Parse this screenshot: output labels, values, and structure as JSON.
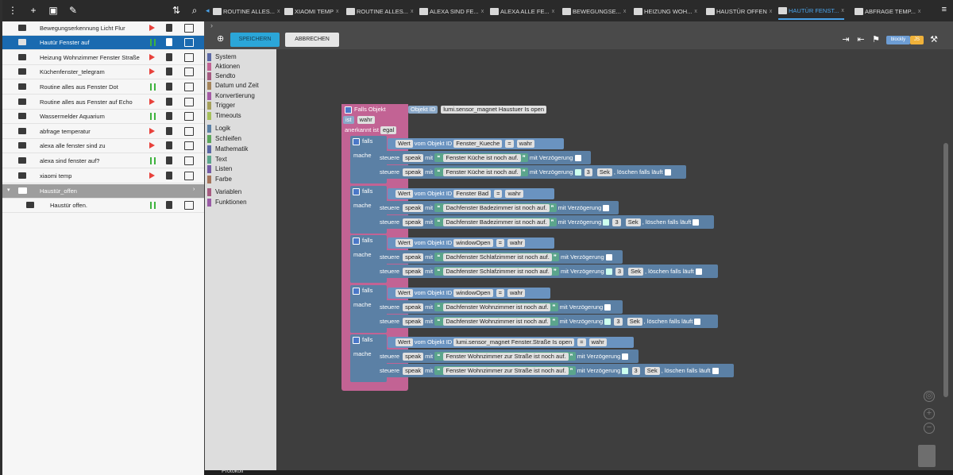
{
  "tabs": [
    {
      "label": "ROUTINE ALLES...",
      "x": "x"
    },
    {
      "label": "XIAOMI TEMP",
      "x": "x"
    },
    {
      "label": "ROUTINE ALLES...",
      "x": "x"
    },
    {
      "label": "ALEXA SIND FE...",
      "x": "x"
    },
    {
      "label": "ALEXA ALLE FE...",
      "x": "x"
    },
    {
      "label": "BEWEGUNGSE...",
      "x": "x"
    },
    {
      "label": "HEIZUNG WOH...",
      "x": "x"
    },
    {
      "label": "HAUSTÜR OFFEN",
      "x": "x"
    },
    {
      "label": "HAUTÜR FENST...",
      "x": "x"
    },
    {
      "label": "ABFRAGE TEMP...",
      "x": "x"
    }
  ],
  "toolbar": {
    "save_label": "SPEICHERN",
    "cancel_label": "ABBRECHEN",
    "blockly_label": "blockly",
    "js_label": "JS"
  },
  "sidebar": {
    "items": [
      {
        "name": "Bewegungserkennung Licht Flur"
      },
      {
        "name": "Hautür Fenster auf"
      },
      {
        "name": "Heizung Wohnzimmer Fenster Straße"
      },
      {
        "name": "Küchenfenster_telegram"
      },
      {
        "name": "Routine alles aus Fenster Dot"
      },
      {
        "name": "Routine alles aus Fenster auf Echo"
      },
      {
        "name": "Wassermelder Aquarium"
      },
      {
        "name": "abfrage temperatur"
      },
      {
        "name": "alexa alle fenster sind zu"
      },
      {
        "name": "alexa sind fenster auf?"
      },
      {
        "name": "xiaomi temp"
      },
      {
        "name": "Haustür_offen"
      },
      {
        "name": "Haustür offen."
      }
    ]
  },
  "categories": [
    "System",
    "Aktionen",
    "Sendto",
    "Datum und Zeit",
    "Konvertierung",
    "Trigger",
    "Timeouts",
    "Logik",
    "Schleifen",
    "Mathematik",
    "Text",
    "Listen",
    "Farbe",
    "Variablen",
    "Funktionen"
  ],
  "cat_colors": [
    "#5b67a5",
    "#c26394",
    "#a55b80",
    "#a5845b",
    "#a55ba5",
    "#a5a05b",
    "#a5c05b",
    "#5b80a5",
    "#5ba55b",
    "#5b67a5",
    "#5ba58c",
    "#745ba5",
    "#a5745b",
    "#a55b80",
    "#995ba5"
  ],
  "trigger": {
    "label": "Falls Objekt",
    "objid": "Objekt ID",
    "objval": "lumi.sensor_magnet Haustuer Is open",
    "ist": "ist",
    "wahr": "wahr",
    "anerkannt": "anerkannt ist",
    "egal": "egal"
  },
  "cond": {
    "falls": "falls",
    "mache": "mache",
    "wert": "Wert",
    "vom": "vom Objekt ID",
    "eq": "=",
    "wahr": "wahr",
    "steuere": "steuere",
    "speak": "speak",
    "mit": "mit",
    "verz": "mit Verzögerung",
    "sek": "Sek",
    "loeschen": ", löschen falls läuft",
    "q": "❝",
    "qc": "❞",
    "n": "3"
  },
  "groups": [
    {
      "obj": "Fenster_Kueche",
      "text1": "Fenster Küche ist noch auf.",
      "text2": "Fenster Küche ist noch auf."
    },
    {
      "obj": "Fenster Bad",
      "text1": "Dachfenster Badezimmer ist noch auf.",
      "text2": "Dachfenster Badezimmer ist noch auf."
    },
    {
      "obj": "windowOpen",
      "text1": "Dachfenster Schlafzimmer ist noch auf.",
      "text2": "Dachfenster Schlafzimmer ist noch auf."
    },
    {
      "obj": "windowOpen",
      "text1": "Dachfenster Wohnzimmer ist noch auf.",
      "text2": "Dachfenster Wohnzimmer ist noch auf."
    },
    {
      "obj": "lumi.sensor_magnet Fenster.Straße Is open",
      "text1": "Fenster Wohnzimmer zur Straße ist noch auf.",
      "text2": "Fenster Wohnzimmer zur Straße ist noch auf."
    }
  ],
  "bottom": {
    "label": "Protokoll"
  }
}
